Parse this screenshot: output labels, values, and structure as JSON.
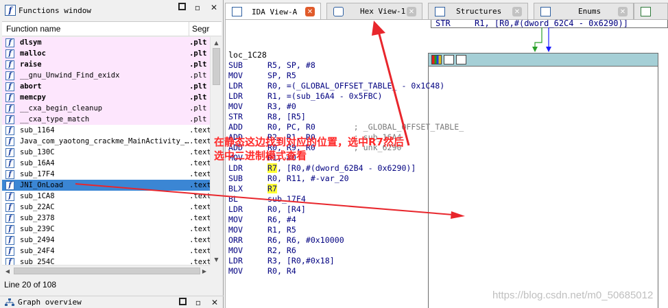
{
  "functions_window": {
    "title": "Functions window",
    "columns": {
      "name": "Function name",
      "segment": "Segr"
    },
    "rows": [
      {
        "name": "dlsym",
        "seg": ".plt",
        "style": "pink",
        "bold": true
      },
      {
        "name": "malloc",
        "seg": ".plt",
        "style": "pink",
        "bold": true
      },
      {
        "name": "raise",
        "seg": ".plt",
        "style": "pink",
        "bold": true
      },
      {
        "name": "__gnu_Unwind_Find_exidx",
        "seg": ".plt",
        "style": "pink",
        "bold": false
      },
      {
        "name": "abort",
        "seg": ".plt",
        "style": "pink",
        "bold": true
      },
      {
        "name": "memcpy",
        "seg": ".plt",
        "style": "pink",
        "bold": true
      },
      {
        "name": "__cxa_begin_cleanup",
        "seg": ".plt",
        "style": "pink",
        "bold": false
      },
      {
        "name": "__cxa_type_match",
        "seg": ".plt",
        "style": "pink",
        "bold": false
      },
      {
        "name": "sub_1164",
        "seg": ".text",
        "style": "white",
        "bold": false
      },
      {
        "name": "Java_com_yaotong_crackme_MainActivity_…",
        "seg": ".text",
        "style": "white",
        "bold": false
      },
      {
        "name": "sub_130C",
        "seg": ".text",
        "style": "white",
        "bold": false
      },
      {
        "name": "sub_16A4",
        "seg": ".text",
        "style": "white",
        "bold": false
      },
      {
        "name": "sub_17F4",
        "seg": ".text",
        "style": "white",
        "bold": false
      },
      {
        "name": "JNI_OnLoad",
        "seg": ".text",
        "style": "selected",
        "bold": false
      },
      {
        "name": "sub_1CA8",
        "seg": ".text",
        "style": "white",
        "bold": false
      },
      {
        "name": "sub_22AC",
        "seg": ".text",
        "style": "white",
        "bold": false
      },
      {
        "name": "sub_2378",
        "seg": ".text",
        "style": "white",
        "bold": false
      },
      {
        "name": "sub_239C",
        "seg": ".text",
        "style": "white",
        "bold": false
      },
      {
        "name": "sub_2494",
        "seg": ".text",
        "style": "white",
        "bold": false
      },
      {
        "name": "sub_24F4",
        "seg": ".text",
        "style": "white",
        "bold": false
      },
      {
        "name": "sub_254C",
        "seg": ".text",
        "style": "white",
        "bold": false
      }
    ],
    "status": "Line 20 of 108",
    "minimize_glyph": "—",
    "close_glyph": "✕"
  },
  "graph_overview": {
    "title": "Graph overview"
  },
  "tabs": [
    {
      "label": "IDA View-A",
      "active": true,
      "icon": "ida-view-icon"
    },
    {
      "label": "Hex View-1",
      "active": false,
      "icon": "hex-view-icon"
    },
    {
      "label": "Structures",
      "active": false,
      "icon": "structures-icon"
    },
    {
      "label": "Enums",
      "active": false,
      "icon": "enums-icon"
    },
    {
      "label": "",
      "active": false,
      "icon": "imports-icon"
    }
  ],
  "ida_view": {
    "top_line": {
      "mn": "STR",
      "op": "R1, [R0,#(dword_62C4 - 0x6290)]"
    },
    "label": "loc_1C28",
    "lines": [
      {
        "mn": "SUB",
        "op": "R5, SP, #8",
        "cm": ""
      },
      {
        "mn": "MOV",
        "op": "SP, R5",
        "cm": ""
      },
      {
        "mn": "LDR",
        "op": "R0, =(_GLOBAL_OFFSET_TABLE_ - 0x1C48)",
        "cm": ""
      },
      {
        "mn": "LDR",
        "op": "R1, =(sub_16A4 - 0x5FBC)",
        "cm": ""
      },
      {
        "mn": "MOV",
        "op": "R3, #0",
        "cm": ""
      },
      {
        "mn": "STR",
        "op": "R8, [R5]",
        "cm": ""
      },
      {
        "mn": "ADD",
        "op": "R0, PC, R0",
        "cm": "; _GLOBAL_OFFSET_TABLE_"
      },
      {
        "mn": "ADD",
        "op": "R2, R1, R0",
        "cm": "; sub_16A4"
      },
      {
        "mn": "ADD",
        "op": "R0, R9, R0",
        "cm": "; unk_6290"
      },
      {
        "mn": "MOV",
        "op": "R1, #0",
        "cm": ""
      },
      {
        "mn": "LDR",
        "op": ", [R0,#(dword_62B4 - 0x6290)]",
        "hl": "R7",
        "cm": ""
      },
      {
        "mn": "SUB",
        "op": "R0, R11, #-var_20",
        "cm": ""
      },
      {
        "mn": "BLX",
        "op": "",
        "hl": "R7",
        "cm": ""
      },
      {
        "mn": "BL",
        "op": "sub_17F4",
        "cm": ""
      },
      {
        "mn": "LDR",
        "op": "R0, [R4]",
        "cm": ""
      },
      {
        "mn": "MOV",
        "op": "R6, #4",
        "cm": ""
      },
      {
        "mn": "MOV",
        "op": "R1, R5",
        "cm": ""
      },
      {
        "mn": "ORR",
        "op": "R6, R6, #0x10000",
        "cm": ""
      },
      {
        "mn": "MOV",
        "op": "R2, R6",
        "cm": ""
      },
      {
        "mn": "LDR",
        "op": "R3, [R0,#0x18]",
        "cm": ""
      },
      {
        "mn": "MOV",
        "op": "R0, R4",
        "cm": ""
      }
    ]
  },
  "annotation": {
    "line1": "在静态这边找到对应的位置，选中R7然后",
    "line2": "选中二进制模式查看",
    "color": "#ff2a2a"
  },
  "watermark": "https://blog.csdn.net/m0_50685012",
  "colors": {
    "selected_row": "#3b86d4",
    "pink_row": "#fde6fd",
    "node_header": "#a5cfd6",
    "highlight": "#ffff33"
  }
}
